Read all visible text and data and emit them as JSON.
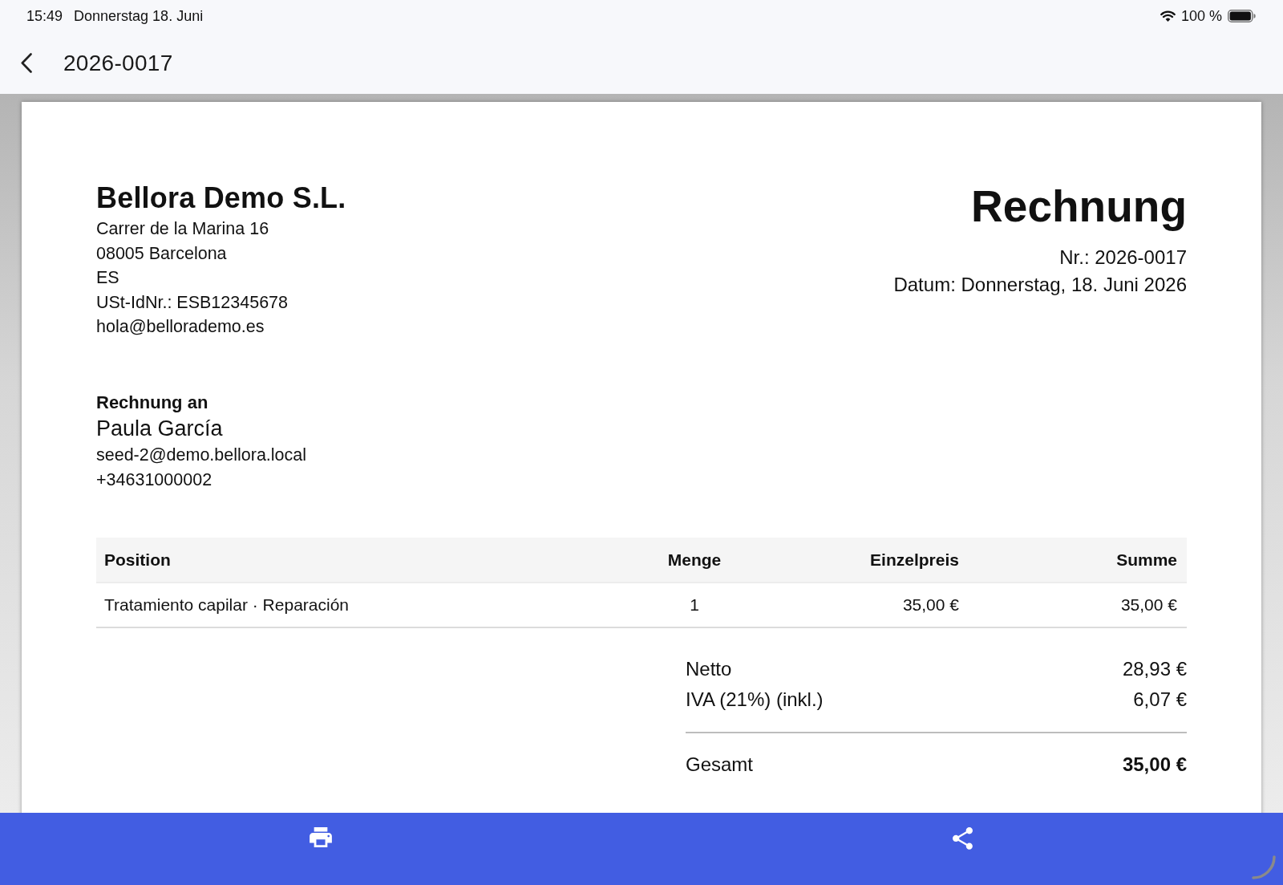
{
  "status_bar": {
    "time": "15:49",
    "date": "Donnerstag 18. Juni",
    "battery_percent": "100 %"
  },
  "app_bar": {
    "title": "2026-0017"
  },
  "invoice": {
    "seller": {
      "name": "Bellora Demo S.L.",
      "lines": [
        "Carrer de la Marina 16",
        "08005 Barcelona",
        "ES",
        "USt-IdNr.: ESB12345678",
        "hola@bellorademo.es"
      ]
    },
    "title": "Rechnung",
    "meta": [
      "Nr.: 2026-0017",
      "Datum: Donnerstag, 18. Juni 2026"
    ],
    "bill_to": {
      "heading": "Rechnung an",
      "name": "Paula García",
      "lines": [
        "seed-2@demo.bellora.local",
        "+34631000002"
      ]
    },
    "table": {
      "columns": [
        "Position",
        "Menge",
        "Einzelpreis",
        "Summe"
      ],
      "rows": [
        [
          "Tratamiento capilar · Reparación",
          "1",
          "35,00 €",
          "35,00 €"
        ]
      ]
    },
    "totals": [
      {
        "kind": "subtotal",
        "label": "Netto",
        "value": "28,93 €"
      },
      {
        "kind": "subtotal",
        "label": "IVA (21%) (inkl.)",
        "value": "6,07 €"
      },
      {
        "kind": "grand",
        "label": "Gesamt",
        "value": "35,00 €"
      }
    ]
  }
}
